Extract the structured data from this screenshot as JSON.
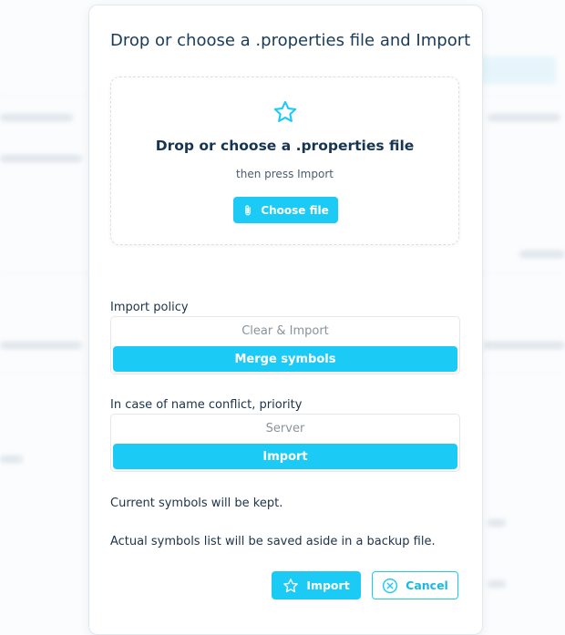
{
  "dialog": {
    "title": "Drop or choose a .properties file and Import",
    "dropzone": {
      "icon": "star-icon",
      "title": "Drop or choose a .properties file",
      "subtitle": "then press Import",
      "choose_button": {
        "label": "Choose file",
        "icon": "paperclip-icon"
      }
    },
    "import_policy": {
      "label": "Import policy",
      "options": [
        "Clear & Import",
        "Merge symbols"
      ],
      "selected": "Merge symbols"
    },
    "conflict_priority": {
      "label": "In case of name conflict, priority",
      "options": [
        "Server",
        "Import"
      ],
      "selected": "Import"
    },
    "info": [
      "Current symbols will be kept.",
      "Actual symbols list will be saved aside in a backup file."
    ],
    "buttons": {
      "import": {
        "label": "Import",
        "icon": "star-icon"
      },
      "cancel": {
        "label": "Cancel",
        "icon": "close-circle-icon"
      }
    }
  },
  "colors": {
    "accent": "#1ccbf5",
    "title_text": "#1a3b58",
    "muted_text": "#8a939b"
  }
}
